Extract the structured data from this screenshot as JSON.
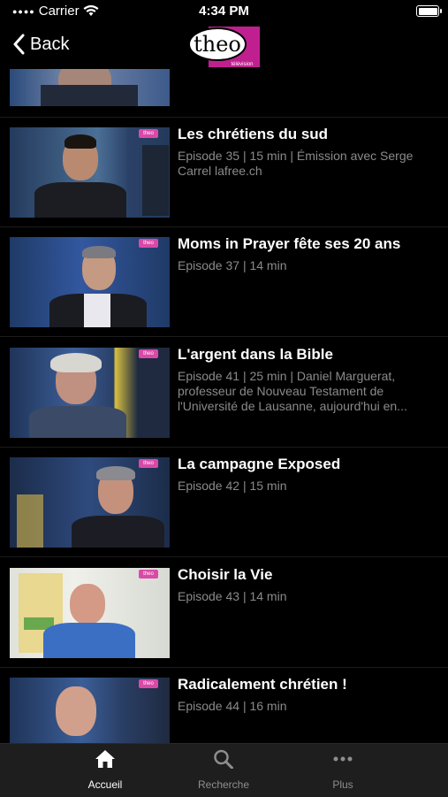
{
  "status": {
    "carrier": "Carrier",
    "time": "4:34 PM"
  },
  "nav": {
    "back_label": "Back",
    "logo_text": "theo",
    "logo_sub": "télévision"
  },
  "episodes": [
    {
      "title": "Les chrétiens du sud",
      "desc": "Episode 35 | 15 min | Émission avec Serge Carrel lafree.ch",
      "thumb_badge": "theo"
    },
    {
      "title": "Moms in Prayer fête ses 20 ans",
      "desc": "Episode 37 | 14 min",
      "thumb_badge": "theo"
    },
    {
      "title": "L'argent dans la Bible",
      "desc": "Episode 41 | 25 min | Daniel Marguerat, professeur de Nouveau Testament de l'Université de Lausanne, aujourd'hui en...",
      "thumb_badge": "theo"
    },
    {
      "title": "La campagne Exposed",
      "desc": "Episode 42 | 15 min",
      "thumb_badge": "theo"
    },
    {
      "title": "Choisir la Vie",
      "desc": "Episode 43 | 14 min",
      "thumb_badge": "theo"
    },
    {
      "title": "Radicalement chrétien !",
      "desc": "Episode 44 | 16 min",
      "thumb_badge": "theo"
    }
  ],
  "tabs": [
    {
      "label": "Accueil",
      "icon": "home-icon",
      "active": true
    },
    {
      "label": "Recherche",
      "icon": "search-icon",
      "active": false
    },
    {
      "label": "Plus",
      "icon": "more-icon",
      "active": false
    }
  ],
  "colors": {
    "accent": "#c0208f",
    "background": "#000000",
    "tabbar": "#1e1e1e",
    "secondary_text": "#8a8a8a"
  }
}
